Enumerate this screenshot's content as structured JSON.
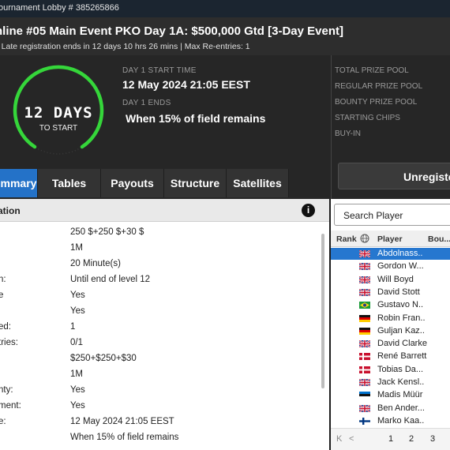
{
  "titlebar": {
    "text": "ournament Lobby # 385265866"
  },
  "header": {
    "title": "nline #05 Main Event PKO Day 1A: $500,000 Gtd [3-Day Event]",
    "subtitle": "| Late registration ends in 12 days 10 hrs  26 mins  | Max Re-entries: 1"
  },
  "countdown": {
    "value": "12 DAYS",
    "sub": "TO START",
    "accent": "#35d63a"
  },
  "day1": {
    "start_label": "DAY 1 START TIME",
    "start_value": "12 May 2024  21:05 EEST",
    "ends_label": "DAY 1 ENDS",
    "ends_value": "When 15% of field remains"
  },
  "prize_labels": [
    "TOTAL PRIZE POOL",
    "REGULAR PRIZE POOL",
    "BOUNTY PRIZE POOL",
    "STARTING CHIPS",
    "BUY-IN"
  ],
  "register_button": "Unregiste",
  "tabs": [
    {
      "label": "mmary",
      "active": true
    },
    {
      "label": "Tables",
      "active": false
    },
    {
      "label": "Payouts",
      "active": false
    },
    {
      "label": "Structure",
      "active": false
    },
    {
      "label": "Satellites",
      "active": false
    }
  ],
  "info": {
    "header": "ation",
    "info_icon": "i",
    "rows": [
      {
        "key": "",
        "value": "250 $+250 $+30 $"
      },
      {
        "key": "",
        "value": "1M"
      },
      {
        "key": "",
        "value": "20 Minute(s)"
      },
      {
        "key": "n:",
        "value": "Until end of level 12"
      },
      {
        "key": "e",
        "value": "Yes"
      },
      {
        "key": "",
        "value": "Yes"
      },
      {
        "key": "ed:",
        "value": "1"
      },
      {
        "key": "tries:",
        "value": "0/1"
      },
      {
        "key": "",
        "value": "$250+$250+$30"
      },
      {
        "key": "",
        "value": "1M"
      },
      {
        "key": "nty:",
        "value": "Yes"
      },
      {
        "key": "ment:",
        "value": "Yes"
      },
      {
        "key": "e:",
        "value": "12 May 2024  21:05 EEST"
      },
      {
        "key": "",
        "value": "When 15% of field remains"
      }
    ]
  },
  "players": {
    "search_placeholder": "Search Player",
    "columns": {
      "rank": "Rank",
      "player": "Player",
      "bounty": "Bou..."
    },
    "rows": [
      {
        "name": "Abdolnass..",
        "flag": "uk",
        "selected": true
      },
      {
        "name": "Gordon W...",
        "flag": "uk",
        "selected": false
      },
      {
        "name": "Will Boyd",
        "flag": "uk",
        "selected": false
      },
      {
        "name": "David Stott",
        "flag": "uk",
        "selected": false
      },
      {
        "name": "Gustavo N..",
        "flag": "brazil",
        "selected": false
      },
      {
        "name": "Robin Fran..",
        "flag": "germany",
        "selected": false
      },
      {
        "name": "Guljan Kaz..",
        "flag": "germany",
        "selected": false
      },
      {
        "name": "David Clarke",
        "flag": "uk",
        "selected": false
      },
      {
        "name": "René Barrett",
        "flag": "nordic-red",
        "selected": false
      },
      {
        "name": "Tobias Da...",
        "flag": "nordic-red",
        "selected": false
      },
      {
        "name": "Jack Kensl..",
        "flag": "uk",
        "selected": false
      },
      {
        "name": "Madis Müür",
        "flag": "estonia",
        "selected": false
      },
      {
        "name": "Ben Ander...",
        "flag": "uk",
        "selected": false
      },
      {
        "name": "Marko Kaa..",
        "flag": "finland",
        "selected": false
      }
    ],
    "pager": {
      "first": "K",
      "prev": "<",
      "pages": [
        "1",
        "2",
        "3"
      ]
    }
  },
  "colors": {
    "tab_active": "#2472c8",
    "row_selected": "#2677cf",
    "ring": "#35d63a"
  },
  "icons": [
    "info-icon",
    "globe-icon",
    "first-page-icon",
    "prev-page-icon"
  ]
}
